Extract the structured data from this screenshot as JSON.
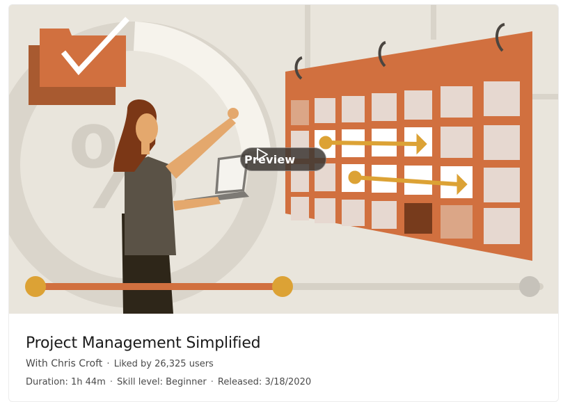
{
  "course": {
    "title": "Project Management Simplified",
    "instructor": "With Chris Croft",
    "likes": "Liked by 26,325 users",
    "duration": "Duration: 1h 44m",
    "skill_level": "Skill level: Beginner",
    "released": "Released: 3/18/2020",
    "separator": "·"
  },
  "thumbnail": {
    "preview_label": "Preview",
    "play_icon": "play-icon",
    "illustration": "woman-pointing-at-calendar",
    "timeline_progress": 0.5
  },
  "colors": {
    "background": "#e9e5dc",
    "accent_orange": "#d1703f",
    "accent_gold": "#dca235",
    "preview_bg": "#3c3734"
  }
}
